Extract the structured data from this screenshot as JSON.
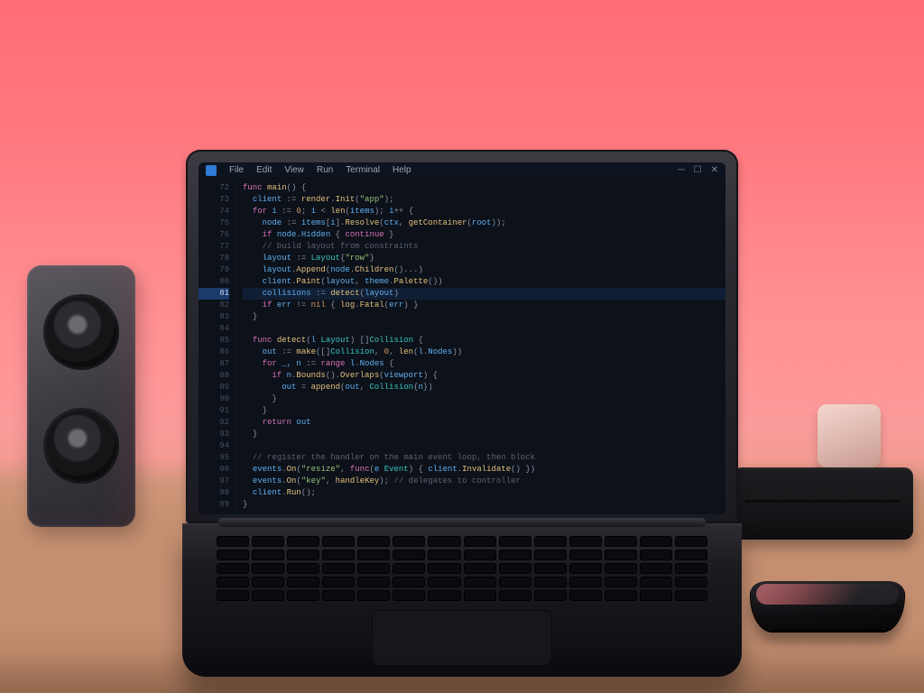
{
  "scene": {
    "description": "Photograph of a silver laptop on a wooden desk, pink back wall. A dark-theme code editor is visible on the laptop screen. A black speaker sits to the left, a small black device and a smartphone to the right.",
    "wall_color": "#ff7a80",
    "desk_color": "#c58f70"
  },
  "editor": {
    "menubar": {
      "app_icon": "vscode-icon",
      "items": [
        "File",
        "Edit",
        "View",
        "Run",
        "Terminal",
        "Help"
      ],
      "window_controls": [
        "minimize-icon",
        "maximize-icon",
        "close-icon"
      ]
    },
    "gutter_start": 72,
    "highlighted_line_index": 9,
    "lines": [
      [
        {
          "c": "kw",
          "t": "func "
        },
        {
          "c": "fn",
          "t": "main"
        },
        {
          "c": "punc",
          "t": "() {"
        }
      ],
      [
        {
          "c": "punc",
          "t": "  "
        },
        {
          "c": "var",
          "t": "client"
        },
        {
          "c": "punc",
          "t": " := "
        },
        {
          "c": "fn",
          "t": "render"
        },
        {
          "c": "punc",
          "t": "."
        },
        {
          "c": "fn",
          "t": "Init"
        },
        {
          "c": "punc",
          "t": "("
        },
        {
          "c": "str",
          "t": "\"app\""
        },
        {
          "c": "punc",
          "t": ");"
        }
      ],
      [
        {
          "c": "punc",
          "t": "  "
        },
        {
          "c": "kw",
          "t": "for "
        },
        {
          "c": "var",
          "t": "i"
        },
        {
          "c": "punc",
          "t": " := "
        },
        {
          "c": "num",
          "t": "0"
        },
        {
          "c": "punc",
          "t": "; "
        },
        {
          "c": "var",
          "t": "i"
        },
        {
          "c": "punc",
          "t": " < "
        },
        {
          "c": "fn",
          "t": "len"
        },
        {
          "c": "punc",
          "t": "("
        },
        {
          "c": "var",
          "t": "items"
        },
        {
          "c": "punc",
          "t": "); "
        },
        {
          "c": "var",
          "t": "i"
        },
        {
          "c": "punc",
          "t": "++ {"
        }
      ],
      [
        {
          "c": "punc",
          "t": "    "
        },
        {
          "c": "var",
          "t": "node"
        },
        {
          "c": "punc",
          "t": " := "
        },
        {
          "c": "var",
          "t": "items"
        },
        {
          "c": "punc",
          "t": "["
        },
        {
          "c": "var",
          "t": "i"
        },
        {
          "c": "punc",
          "t": "]."
        },
        {
          "c": "fn",
          "t": "Resolve"
        },
        {
          "c": "punc",
          "t": "("
        },
        {
          "c": "var",
          "t": "ctx"
        },
        {
          "c": "punc",
          "t": ", "
        },
        {
          "c": "fn",
          "t": "getContainer"
        },
        {
          "c": "punc",
          "t": "("
        },
        {
          "c": "var",
          "t": "root"
        },
        {
          "c": "punc",
          "t": "));"
        }
      ],
      [
        {
          "c": "punc",
          "t": "    "
        },
        {
          "c": "kw",
          "t": "if "
        },
        {
          "c": "var",
          "t": "node"
        },
        {
          "c": "punc",
          "t": "."
        },
        {
          "c": "var",
          "t": "Hidden"
        },
        {
          "c": "punc",
          "t": " { "
        },
        {
          "c": "kw",
          "t": "continue"
        },
        {
          "c": "punc",
          "t": " }"
        }
      ],
      [
        {
          "c": "punc",
          "t": "    "
        },
        {
          "c": "cmt",
          "t": "// build layout from constraints"
        }
      ],
      [
        {
          "c": "punc",
          "t": "    "
        },
        {
          "c": "var",
          "t": "layout"
        },
        {
          "c": "punc",
          "t": " := "
        },
        {
          "c": "type",
          "t": "Layout"
        },
        {
          "c": "punc",
          "t": "{"
        },
        {
          "c": "str",
          "t": "\"row\""
        },
        {
          "c": "punc",
          "t": "}"
        }
      ],
      [
        {
          "c": "punc",
          "t": "    "
        },
        {
          "c": "var",
          "t": "layout"
        },
        {
          "c": "punc",
          "t": "."
        },
        {
          "c": "fn",
          "t": "Append"
        },
        {
          "c": "punc",
          "t": "("
        },
        {
          "c": "var",
          "t": "node"
        },
        {
          "c": "punc",
          "t": "."
        },
        {
          "c": "fn",
          "t": "Children"
        },
        {
          "c": "punc",
          "t": "()...)"
        }
      ],
      [
        {
          "c": "punc",
          "t": "    "
        },
        {
          "c": "var",
          "t": "client"
        },
        {
          "c": "punc",
          "t": "."
        },
        {
          "c": "fn",
          "t": "Paint"
        },
        {
          "c": "punc",
          "t": "("
        },
        {
          "c": "var",
          "t": "layout"
        },
        {
          "c": "punc",
          "t": ", "
        },
        {
          "c": "var",
          "t": "theme"
        },
        {
          "c": "punc",
          "t": "."
        },
        {
          "c": "fn",
          "t": "Palette"
        },
        {
          "c": "punc",
          "t": "())"
        }
      ],
      [
        {
          "c": "punc",
          "t": "    "
        },
        {
          "c": "var",
          "t": "collisions"
        },
        {
          "c": "punc",
          "t": " := "
        },
        {
          "c": "fn",
          "t": "detect"
        },
        {
          "c": "punc",
          "t": "("
        },
        {
          "c": "var",
          "t": "layout"
        },
        {
          "c": "punc",
          "t": ")"
        }
      ],
      [
        {
          "c": "punc",
          "t": "    "
        },
        {
          "c": "kw",
          "t": "if "
        },
        {
          "c": "var",
          "t": "err"
        },
        {
          "c": "punc",
          "t": " != "
        },
        {
          "c": "lit",
          "t": "nil"
        },
        {
          "c": "punc",
          "t": " { "
        },
        {
          "c": "fn",
          "t": "log"
        },
        {
          "c": "punc",
          "t": "."
        },
        {
          "c": "fn",
          "t": "Fatal"
        },
        {
          "c": "punc",
          "t": "("
        },
        {
          "c": "var",
          "t": "err"
        },
        {
          "c": "punc",
          "t": ") }"
        }
      ],
      [
        {
          "c": "punc",
          "t": "  "
        },
        {
          "c": "punc",
          "t": "}"
        }
      ],
      [
        {
          "c": "punc",
          "t": ""
        }
      ],
      [
        {
          "c": "punc",
          "t": "  "
        },
        {
          "c": "kw",
          "t": "func "
        },
        {
          "c": "fn",
          "t": "detect"
        },
        {
          "c": "punc",
          "t": "("
        },
        {
          "c": "var",
          "t": "l"
        },
        {
          "c": "punc",
          "t": " "
        },
        {
          "c": "type",
          "t": "Layout"
        },
        {
          "c": "punc",
          "t": ") []"
        },
        {
          "c": "type",
          "t": "Collision"
        },
        {
          "c": "punc",
          "t": " {"
        }
      ],
      [
        {
          "c": "punc",
          "t": "    "
        },
        {
          "c": "var",
          "t": "out"
        },
        {
          "c": "punc",
          "t": " := "
        },
        {
          "c": "fn",
          "t": "make"
        },
        {
          "c": "punc",
          "t": "([]"
        },
        {
          "c": "type",
          "t": "Collision"
        },
        {
          "c": "punc",
          "t": ", "
        },
        {
          "c": "num",
          "t": "0"
        },
        {
          "c": "punc",
          "t": ", "
        },
        {
          "c": "fn",
          "t": "len"
        },
        {
          "c": "punc",
          "t": "("
        },
        {
          "c": "var",
          "t": "l"
        },
        {
          "c": "punc",
          "t": "."
        },
        {
          "c": "var",
          "t": "Nodes"
        },
        {
          "c": "punc",
          "t": "))"
        }
      ],
      [
        {
          "c": "punc",
          "t": "    "
        },
        {
          "c": "kw",
          "t": "for "
        },
        {
          "c": "var",
          "t": "_, n"
        },
        {
          "c": "punc",
          "t": " := "
        },
        {
          "c": "kw",
          "t": "range "
        },
        {
          "c": "var",
          "t": "l"
        },
        {
          "c": "punc",
          "t": "."
        },
        {
          "c": "var",
          "t": "Nodes"
        },
        {
          "c": "punc",
          "t": " {"
        }
      ],
      [
        {
          "c": "punc",
          "t": "      "
        },
        {
          "c": "kw",
          "t": "if "
        },
        {
          "c": "var",
          "t": "n"
        },
        {
          "c": "punc",
          "t": "."
        },
        {
          "c": "fn",
          "t": "Bounds"
        },
        {
          "c": "punc",
          "t": "()."
        },
        {
          "c": "fn",
          "t": "Overlaps"
        },
        {
          "c": "punc",
          "t": "("
        },
        {
          "c": "var",
          "t": "viewport"
        },
        {
          "c": "punc",
          "t": ") {"
        }
      ],
      [
        {
          "c": "punc",
          "t": "        "
        },
        {
          "c": "var",
          "t": "out"
        },
        {
          "c": "punc",
          "t": " = "
        },
        {
          "c": "fn",
          "t": "append"
        },
        {
          "c": "punc",
          "t": "("
        },
        {
          "c": "var",
          "t": "out"
        },
        {
          "c": "punc",
          "t": ", "
        },
        {
          "c": "type",
          "t": "Collision"
        },
        {
          "c": "punc",
          "t": "{"
        },
        {
          "c": "var",
          "t": "n"
        },
        {
          "c": "punc",
          "t": "})"
        }
      ],
      [
        {
          "c": "punc",
          "t": "      "
        },
        {
          "c": "punc",
          "t": "}"
        }
      ],
      [
        {
          "c": "punc",
          "t": "    "
        },
        {
          "c": "punc",
          "t": "}"
        }
      ],
      [
        {
          "c": "punc",
          "t": "    "
        },
        {
          "c": "kw",
          "t": "return "
        },
        {
          "c": "var",
          "t": "out"
        }
      ],
      [
        {
          "c": "punc",
          "t": "  "
        },
        {
          "c": "punc",
          "t": "}"
        }
      ],
      [
        {
          "c": "punc",
          "t": ""
        }
      ],
      [
        {
          "c": "punc",
          "t": "  "
        },
        {
          "c": "cmt",
          "t": "// register the handler on the main event loop, then block"
        }
      ],
      [
        {
          "c": "punc",
          "t": "  "
        },
        {
          "c": "var",
          "t": "events"
        },
        {
          "c": "punc",
          "t": "."
        },
        {
          "c": "fn",
          "t": "On"
        },
        {
          "c": "punc",
          "t": "("
        },
        {
          "c": "str",
          "t": "\"resize\""
        },
        {
          "c": "punc",
          "t": ", "
        },
        {
          "c": "kw",
          "t": "func"
        },
        {
          "c": "punc",
          "t": "("
        },
        {
          "c": "var",
          "t": "e"
        },
        {
          "c": "punc",
          "t": " "
        },
        {
          "c": "type",
          "t": "Event"
        },
        {
          "c": "punc",
          "t": ") { "
        },
        {
          "c": "var",
          "t": "client"
        },
        {
          "c": "punc",
          "t": "."
        },
        {
          "c": "fn",
          "t": "Invalidate"
        },
        {
          "c": "punc",
          "t": "() })"
        }
      ],
      [
        {
          "c": "punc",
          "t": "  "
        },
        {
          "c": "var",
          "t": "events"
        },
        {
          "c": "punc",
          "t": "."
        },
        {
          "c": "fn",
          "t": "On"
        },
        {
          "c": "punc",
          "t": "("
        },
        {
          "c": "str",
          "t": "\"key\""
        },
        {
          "c": "punc",
          "t": ", "
        },
        {
          "c": "fn",
          "t": "handleKey"
        },
        {
          "c": "punc",
          "t": "); "
        },
        {
          "c": "cmt",
          "t": "// delegates to controller"
        }
      ],
      [
        {
          "c": "punc",
          "t": "  "
        },
        {
          "c": "var",
          "t": "client"
        },
        {
          "c": "punc",
          "t": "."
        },
        {
          "c": "fn",
          "t": "Run"
        },
        {
          "c": "punc",
          "t": "();"
        }
      ],
      [
        {
          "c": "punc",
          "t": "}"
        }
      ]
    ]
  }
}
